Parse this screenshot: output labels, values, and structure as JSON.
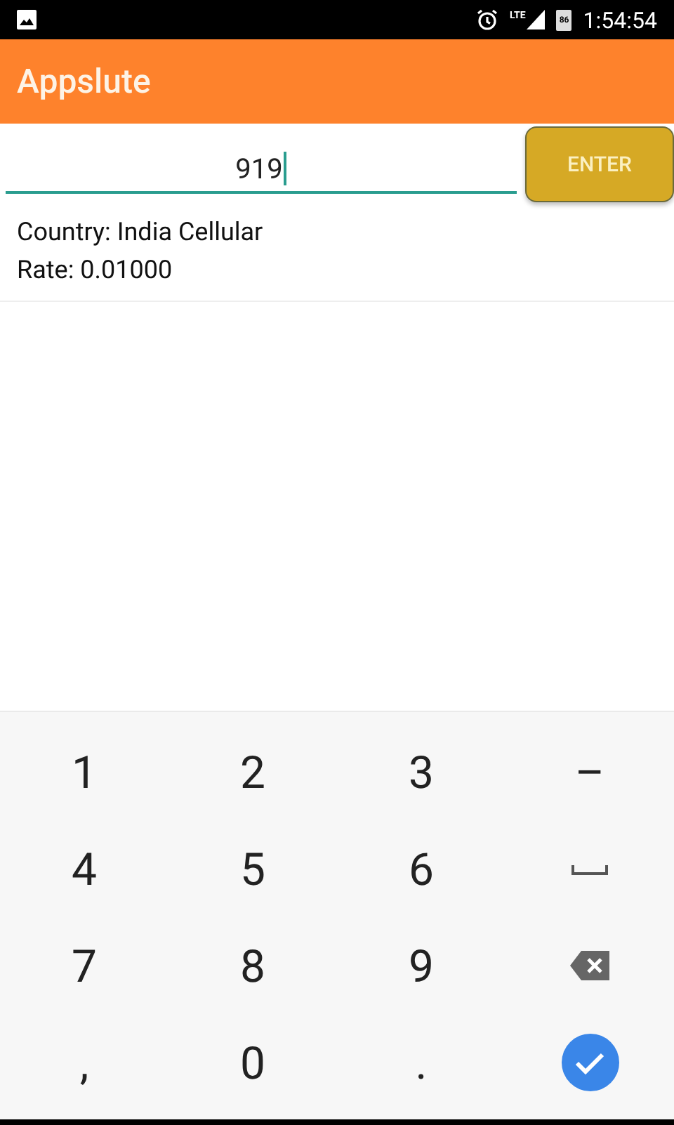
{
  "status_bar": {
    "network": "LTE",
    "battery": "86",
    "time": "1:54:54"
  },
  "app_bar": {
    "title": "Appslute"
  },
  "entry": {
    "value": "919",
    "focused": true,
    "button": "ENTER"
  },
  "result": {
    "lines": [
      "Country: India Cellular",
      "Rate: 0.01000"
    ]
  },
  "keyboard": {
    "rows": [
      [
        {
          "kind": "char",
          "label": "1"
        },
        {
          "kind": "char",
          "label": "2"
        },
        {
          "kind": "char",
          "label": "3"
        },
        {
          "kind": "char",
          "label": "–"
        }
      ],
      [
        {
          "kind": "char",
          "label": "4"
        },
        {
          "kind": "char",
          "label": "5"
        },
        {
          "kind": "char",
          "label": "6"
        },
        {
          "kind": "space"
        }
      ],
      [
        {
          "kind": "char",
          "label": "7"
        },
        {
          "kind": "char",
          "label": "8"
        },
        {
          "kind": "char",
          "label": "9"
        },
        {
          "kind": "backspace"
        }
      ],
      [
        {
          "kind": "char",
          "label": ","
        },
        {
          "kind": "char",
          "label": "0"
        },
        {
          "kind": "char",
          "label": "."
        },
        {
          "kind": "done"
        }
      ]
    ]
  }
}
